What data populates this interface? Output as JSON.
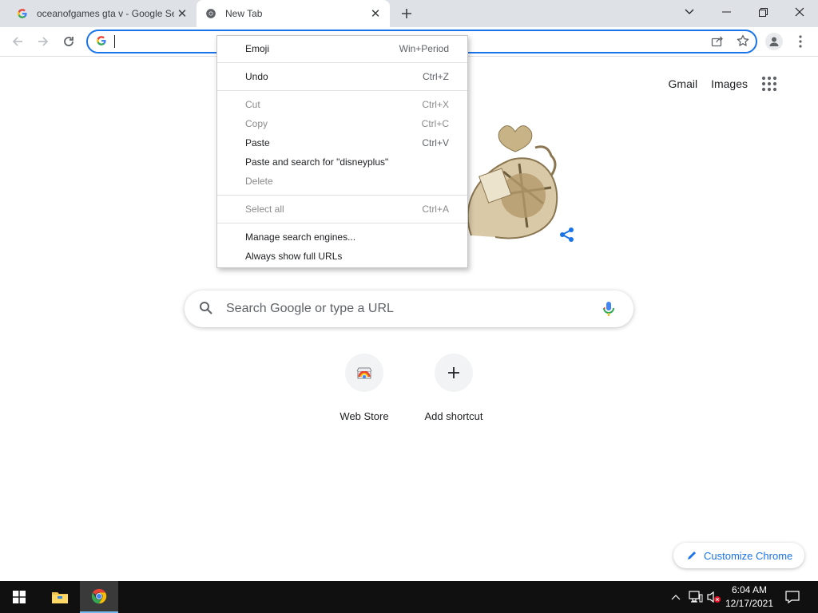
{
  "tabs": [
    {
      "title": "oceanofgames gta v - Google Se",
      "favicon": "google-g-icon",
      "active": false
    },
    {
      "title": "New Tab",
      "favicon": "chrome-icon",
      "active": true
    }
  ],
  "window_controls": [
    "tab-search-icon",
    "minimize-icon",
    "restore-icon",
    "close-icon"
  ],
  "omnibox": {
    "value": "",
    "search_engine_icon": "google-g-icon"
  },
  "ntp": {
    "gmail": "Gmail",
    "images": "Images",
    "search_placeholder": "Search Google or type a URL",
    "shortcuts": [
      {
        "label": "Web Store",
        "icon": "web-store-icon"
      },
      {
        "label": "Add shortcut",
        "icon": "plus-icon"
      }
    ],
    "customize": "Customize Chrome"
  },
  "context_menu": {
    "items": [
      {
        "label": "Emoji",
        "shortcut": "Win+Period",
        "disabled": false
      },
      {
        "label": "Undo",
        "shortcut": "Ctrl+Z",
        "disabled": false
      },
      {
        "label": "Cut",
        "shortcut": "Ctrl+X",
        "disabled": true
      },
      {
        "label": "Copy",
        "shortcut": "Ctrl+C",
        "disabled": true
      },
      {
        "label": "Paste",
        "shortcut": "Ctrl+V",
        "disabled": false
      },
      {
        "label": "Paste and search for \"disneyplus\"",
        "shortcut": "",
        "disabled": false
      },
      {
        "label": "Delete",
        "shortcut": "",
        "disabled": true
      },
      {
        "label": "Select all",
        "shortcut": "Ctrl+A",
        "disabled": true
      },
      {
        "label": "Manage search engines...",
        "shortcut": "",
        "disabled": false
      },
      {
        "label": "Always show full URLs",
        "shortcut": "",
        "disabled": false
      }
    ]
  },
  "taskbar": {
    "time": "6:04 AM",
    "date": "12/17/2021"
  },
  "colors": {
    "accent": "#1a73e8",
    "taskbar": "#101010",
    "tabstrip": "#dee1e6"
  }
}
